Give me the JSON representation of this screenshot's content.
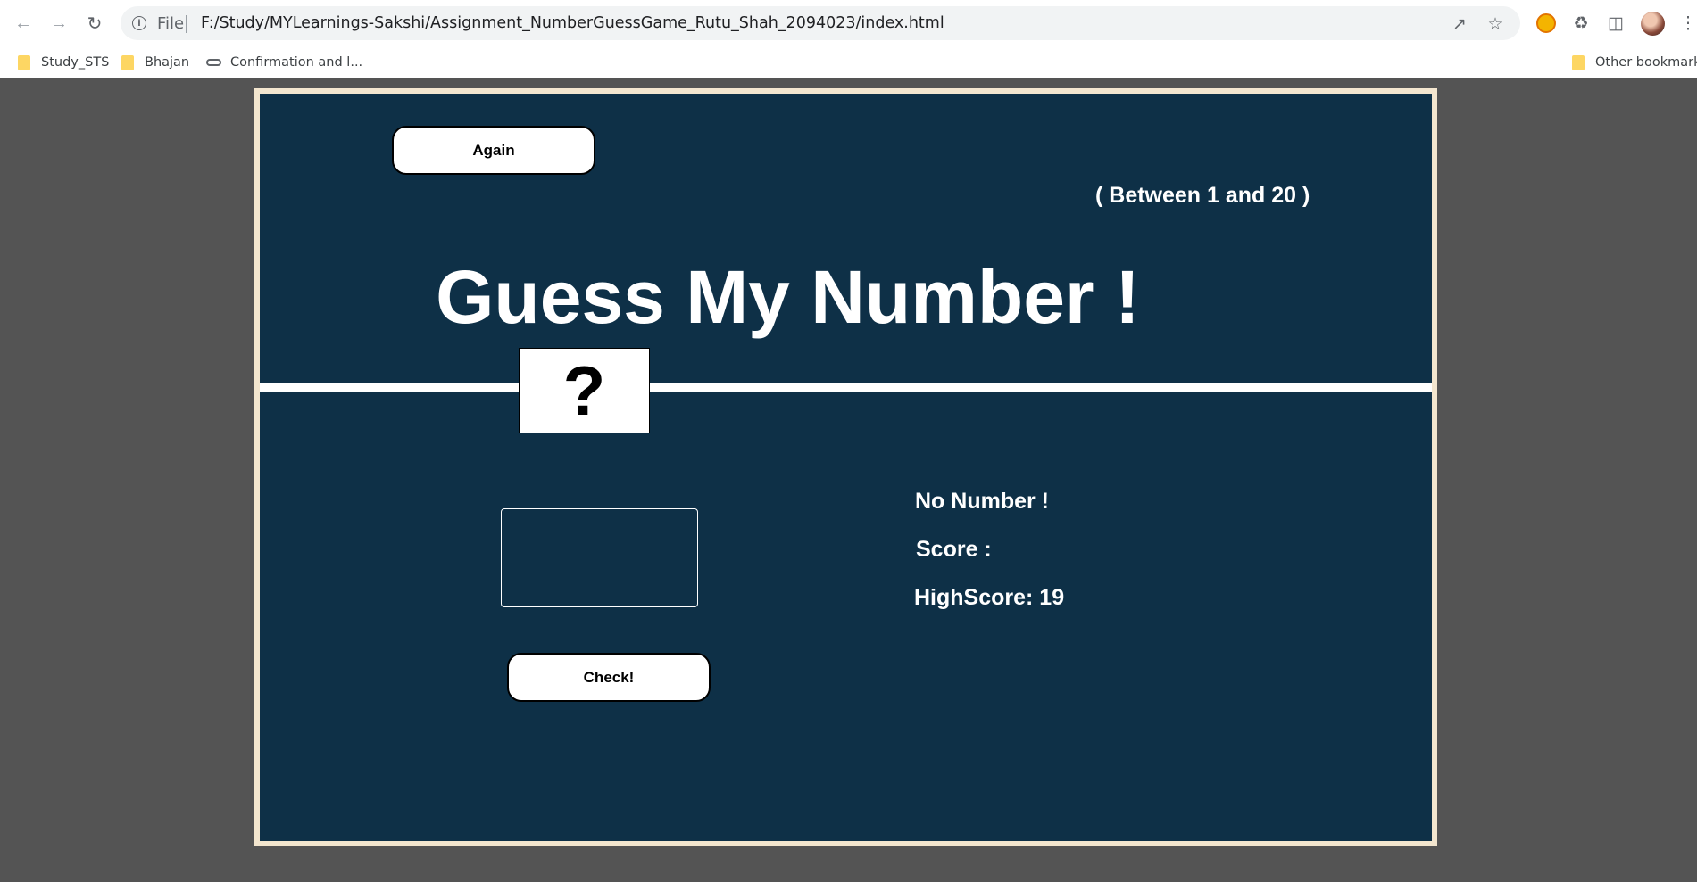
{
  "browser": {
    "scheme": "File",
    "url": "F:/Study/MYLearnings-Sakshi/Assignment_NumberGuessGame_Rutu_Shah_2094023/index.html",
    "bookmarks": [
      {
        "label": "Study_STS",
        "icon": "folder-icon"
      },
      {
        "label": "Bhajan",
        "icon": "folder-icon"
      },
      {
        "label": "Confirmation and l...",
        "icon": "link-icon"
      }
    ],
    "other_bookmarks": "Other bookmarks"
  },
  "game": {
    "again_label": "Again",
    "range_text": "( Between 1 and 20 )",
    "title": "Guess My Number !",
    "secret": "?",
    "guess_value": "",
    "check_label": "Check!",
    "message": "No Number !",
    "score_text": "Score :",
    "highscore_text": "HighScore: 19"
  },
  "colors": {
    "background": "#0e3047",
    "frame_border": "#f3e6cf",
    "page_outer": "#545454"
  }
}
